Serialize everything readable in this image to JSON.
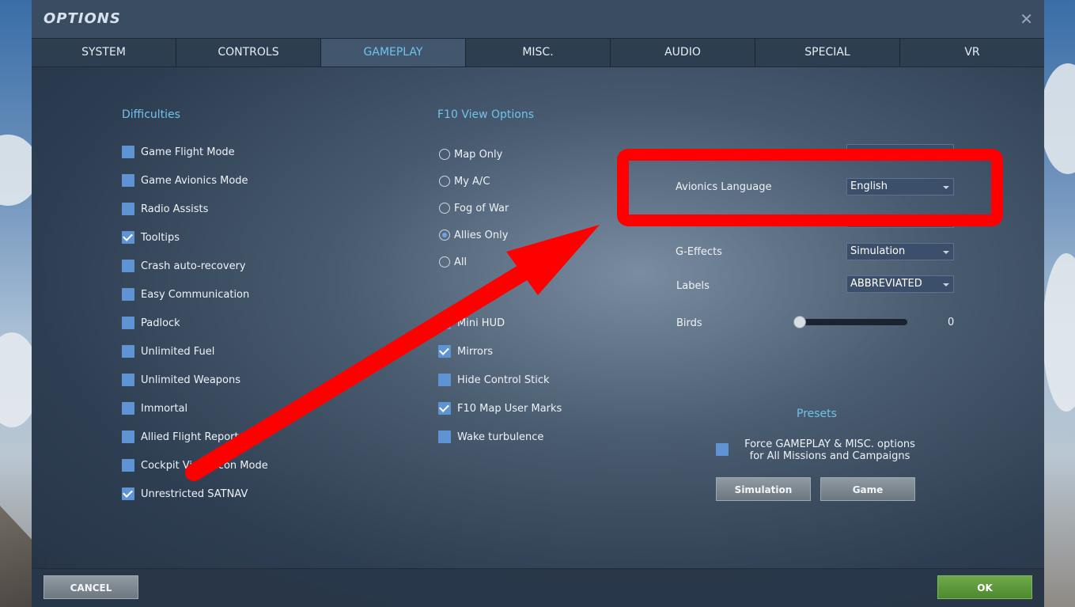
{
  "window": {
    "title": "OPTIONS"
  },
  "tabs": [
    {
      "label": "SYSTEM"
    },
    {
      "label": "CONTROLS"
    },
    {
      "label": "GAMEPLAY"
    },
    {
      "label": "MISC."
    },
    {
      "label": "AUDIO"
    },
    {
      "label": "SPECIAL"
    },
    {
      "label": "VR"
    }
  ],
  "active_tab": "GAMEPLAY",
  "difficulties": {
    "title": "Difficulties",
    "items": [
      {
        "label": "Game Flight Mode",
        "checked": false
      },
      {
        "label": "Game Avionics Mode",
        "checked": false
      },
      {
        "label": "Radio Assists",
        "checked": false
      },
      {
        "label": "Tooltips",
        "checked": true
      },
      {
        "label": "Crash auto-recovery",
        "checked": false
      },
      {
        "label": "Easy Communication",
        "checked": false
      },
      {
        "label": "Padlock",
        "checked": false
      },
      {
        "label": "Unlimited Fuel",
        "checked": false
      },
      {
        "label": "Unlimited Weapons",
        "checked": false
      },
      {
        "label": "Immortal",
        "checked": false
      },
      {
        "label": "Allied Flight Reports",
        "checked": false
      },
      {
        "label": "Cockpit Vi      econ Mode",
        "checked": false
      },
      {
        "label": "Unrestricted SATNAV",
        "checked": true
      }
    ]
  },
  "f10": {
    "title": "F10 View Options",
    "radios": [
      {
        "label": "Map Only",
        "checked": false
      },
      {
        "label": "My A/C",
        "checked": false
      },
      {
        "label": "Fog of War",
        "checked": false
      },
      {
        "label": "Allies Only",
        "checked": true
      },
      {
        "label": "All",
        "checked": false
      }
    ],
    "checks": [
      {
        "label": "Mini HUD",
        "checked": false
      },
      {
        "label": "Mirrors",
        "checked": true
      },
      {
        "label": "Hide Control Stick",
        "checked": false
      },
      {
        "label": "F10 Map User Marks",
        "checked": true
      },
      {
        "label": "Wake turbulence",
        "checked": false
      }
    ]
  },
  "settings": {
    "avionics_language": {
      "label": "Avionics Language",
      "value": "English"
    },
    "g_effects": {
      "label": "G-Effects",
      "value": "Simulation"
    },
    "labels": {
      "label": "Labels",
      "value": "ABBREVIATED"
    },
    "birds": {
      "label": "Birds",
      "value": "0",
      "level": 0
    }
  },
  "presets": {
    "title": "Presets",
    "force_line1": "Force GAMEPLAY & MISC. options",
    "force_line2": "for All Missions and Campaigns",
    "force_checked": false,
    "simulation_label": "Simulation",
    "game_label": "Game"
  },
  "footer": {
    "cancel_label": "CANCEL",
    "ok_label": "OK"
  },
  "colors": {
    "accent": "#6fc3ea",
    "checkbox": "#5f93d4",
    "ok": "#5a9a3a",
    "annotation": "#ff0000"
  }
}
